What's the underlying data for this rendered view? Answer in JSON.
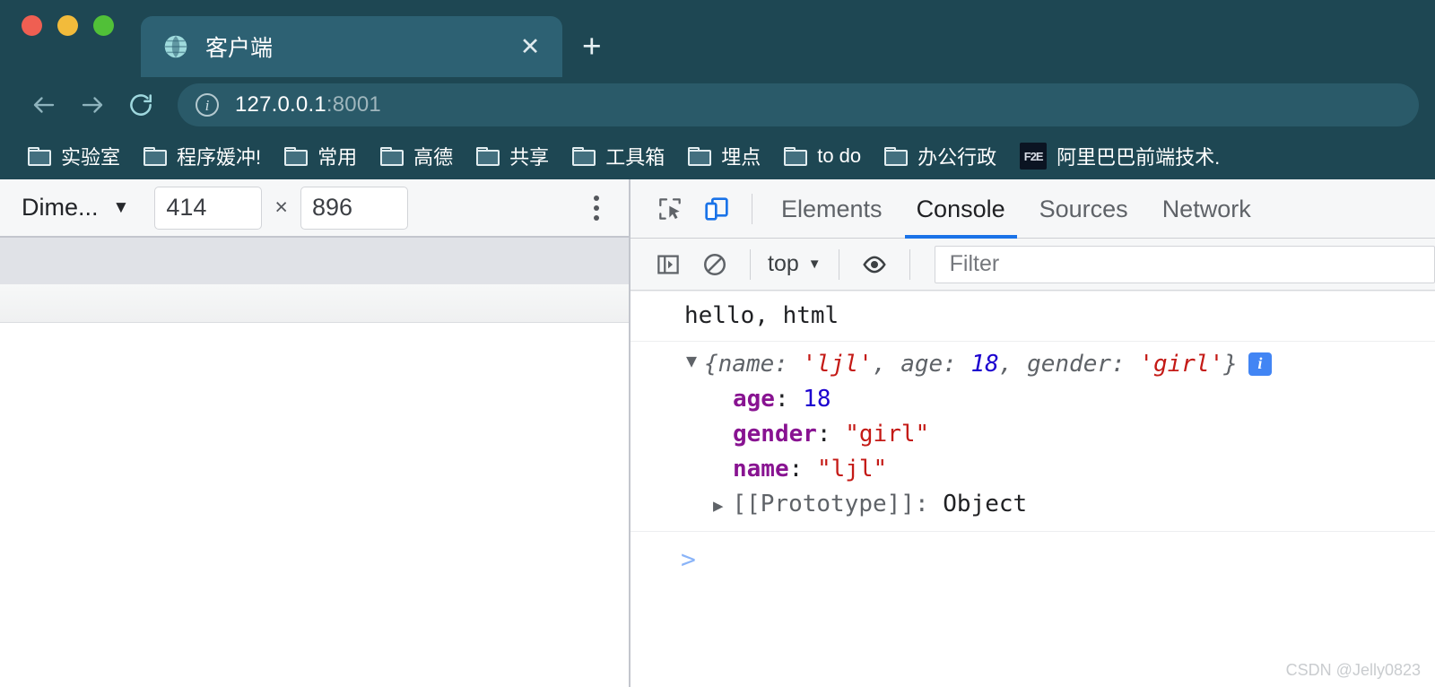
{
  "window": {
    "traffic_lights": [
      "close",
      "minimize",
      "maximize"
    ]
  },
  "tabstrip": {
    "tab_title": "客户端",
    "favicon": "globe-icon",
    "close_label": "✕",
    "newtab_label": "+"
  },
  "toolbar": {
    "back_icon": "arrow-left-icon",
    "forward_icon": "arrow-right-icon",
    "reload_icon": "reload-icon",
    "site_info_icon": "info-circle-icon",
    "url_host": "127.0.0.1",
    "url_port": ":8001"
  },
  "bookmarks": {
    "items": [
      {
        "label": "实验室",
        "icon": "folder-icon"
      },
      {
        "label": "程序媛冲!",
        "icon": "folder-icon"
      },
      {
        "label": "常用",
        "icon": "folder-icon"
      },
      {
        "label": "高德",
        "icon": "folder-icon"
      },
      {
        "label": "共享",
        "icon": "folder-icon"
      },
      {
        "label": "工具箱",
        "icon": "folder-icon"
      },
      {
        "label": "埋点",
        "icon": "folder-icon"
      },
      {
        "label": "to do",
        "icon": "folder-icon"
      },
      {
        "label": "办公行政",
        "icon": "folder-icon"
      },
      {
        "label": "阿里巴巴前端技术.",
        "icon": "f2e-favicon",
        "favicon_text": "F2E"
      }
    ]
  },
  "device_toolbar": {
    "device_label": "Dime...",
    "caret": "▼",
    "width": "414",
    "height": "896",
    "times": "×",
    "more_icon": "kebab-menu-icon"
  },
  "devtools": {
    "inspect_icon": "inspect-element-icon",
    "device_toggle_icon": "device-toolbar-icon",
    "tabs": [
      {
        "label": "Elements",
        "active": false
      },
      {
        "label": "Console",
        "active": true
      },
      {
        "label": "Sources",
        "active": false
      },
      {
        "label": "Network",
        "active": false
      }
    ],
    "console_toolbar": {
      "sidebar_icon": "console-sidebar-icon",
      "clear_icon": "clear-console-icon",
      "context_label": "top",
      "context_caret": "▼",
      "eye_icon": "live-expression-icon",
      "filter_placeholder": "Filter"
    },
    "console_messages": {
      "log_text": "hello, html",
      "object_preview": {
        "triangle": "▼",
        "open_brace": "{",
        "close_brace": "}",
        "entries": [
          {
            "key": "name",
            "value": "'ljl'",
            "type": "string"
          },
          {
            "key": "age",
            "value": "18",
            "type": "number"
          },
          {
            "key": "gender",
            "value": "'girl'",
            "type": "string"
          }
        ],
        "info_badge": "i"
      },
      "properties": [
        {
          "key": "age",
          "value": "18",
          "type": "number"
        },
        {
          "key": "gender",
          "value": "\"girl\"",
          "type": "string"
        },
        {
          "key": "name",
          "value": "\"ljl\"",
          "type": "string"
        }
      ],
      "prototype": {
        "triangle": "▶",
        "label": "[[Prototype]]",
        "colon": ": ",
        "value": "Object"
      }
    },
    "prompt": ">"
  },
  "watermark": "CSDN @Jelly0823",
  "colors": {
    "chrome_bg": "#1e4753",
    "tab_active_bg": "#2d6173",
    "accent_blue": "#1a73e8",
    "string_red": "#c41a16",
    "number_blue": "#1c00cf",
    "property_purple": "#881391"
  }
}
